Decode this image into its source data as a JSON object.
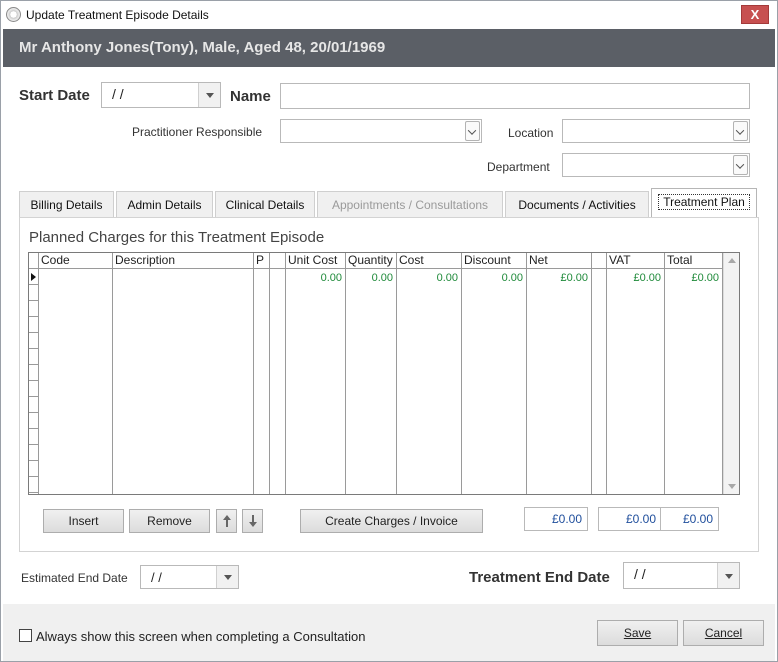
{
  "window": {
    "title": "Update Treatment Episode Details",
    "close_glyph": "X"
  },
  "patient_header": "Mr Anthony Jones(Tony), Male, Aged 48, 20/01/1969",
  "form": {
    "start_date_label": "Start Date",
    "start_date_value": "/ /",
    "name_label": "Name",
    "name_value": "",
    "practitioner_label": "Practitioner Responsible",
    "practitioner_value": "",
    "location_label": "Location",
    "location_value": "",
    "department_label": "Department",
    "department_value": ""
  },
  "tabs": [
    {
      "label": "Billing Details",
      "state": "normal"
    },
    {
      "label": "Admin Details",
      "state": "normal"
    },
    {
      "label": "Clinical Details",
      "state": "normal"
    },
    {
      "label": "Appointments / Consultations",
      "state": "disabled"
    },
    {
      "label": "Documents / Activities",
      "state": "normal"
    },
    {
      "label": "Treatment Plan",
      "state": "active"
    }
  ],
  "charges": {
    "section_title": "Planned Charges for this Treatment Episode",
    "columns": [
      "Code",
      "Description",
      "P",
      "",
      "Unit Cost",
      "Quantity",
      "Cost",
      "Discount",
      "Net",
      "",
      "VAT",
      "Total"
    ],
    "rows": [
      {
        "code": "",
        "description": "",
        "p": "",
        "flag": "",
        "unit_cost": "0.00",
        "quantity": "0.00",
        "cost": "0.00",
        "discount": "0.00",
        "net": "£0.00",
        "extra": "",
        "vat": "£0.00",
        "total": "£0.00"
      }
    ],
    "buttons": {
      "insert": "Insert",
      "remove": "Remove",
      "move_up_icon": "arrow-up-icon",
      "move_down_icon": "arrow-down-icon",
      "create_charges": "Create Charges / Invoice"
    },
    "totals": {
      "net": "£0.00",
      "vat": "£0.00",
      "total": "£0.00"
    }
  },
  "end_dates": {
    "estimated_end_label": "Estimated End Date",
    "estimated_end_value": "/ /",
    "treatment_end_label": "Treatment End Date",
    "treatment_end_value": "/ /"
  },
  "footer": {
    "always_show_label": "Always show this screen when completing a Consultation",
    "always_show_checked": false,
    "save_label": "Save",
    "cancel_label": "Cancel"
  },
  "colors": {
    "header_band": "#5b5f66",
    "grid_value": "#1f8a3a",
    "total_value": "#1f4e9c",
    "close_button": "#c75050"
  }
}
